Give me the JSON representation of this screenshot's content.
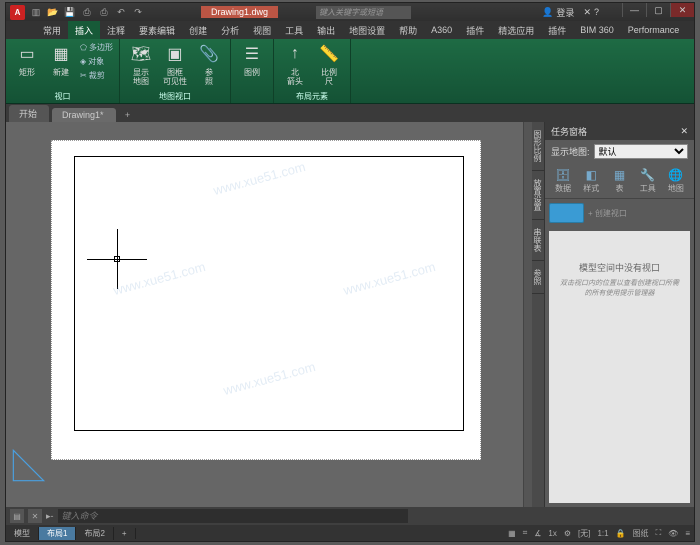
{
  "title_filename": "Drawing1.dwg",
  "search_placeholder": "键入关键字或短语",
  "user_label": "登录",
  "ribbon_tabs": [
    "常用",
    "插入",
    "注释",
    "要素编辑",
    "创建",
    "分析",
    "视图",
    "工具",
    "输出",
    "地图设置",
    "帮助",
    "A360",
    "插件",
    "精选应用",
    "插件",
    "BIM 360",
    "Performance"
  ],
  "ribbon_active_tab": "插入",
  "panels": {
    "viewport": {
      "label": "视口",
      "btn_rect": "矩形",
      "btn_new": "新建",
      "small1": "多边形",
      "small2": "对象",
      "small3": "裁剪"
    },
    "mapview": {
      "label": "地图视口",
      "btn_show": "显示\n地图",
      "btn_imgframe": "图框\n可见性",
      "btn_ref": "参\n照"
    },
    "legend": {
      "label": " ",
      "btn_legend": "图例"
    },
    "layout": {
      "label": "布局元素",
      "btn_north": "北\n箭头",
      "btn_scale": "比例\n尺"
    }
  },
  "doc_tabs": [
    "开始",
    "Drawing1*"
  ],
  "side_tabs": [
    "图形比例",
    "放置设置",
    "串联表",
    "参照"
  ],
  "taskpane": {
    "title": "任务窗格",
    "showmap": "显示地图:",
    "default_option": "默认",
    "tools": [
      "数据",
      "样式",
      "表",
      "工具",
      "地图"
    ],
    "viewport_hint": "+ 创建视口",
    "empty_msg": "模型空间中没有视口",
    "empty_hint": "双击视口内的位置以查看创建视口所需的所有使用提示管理器"
  },
  "cmd_prefix": "▸-",
  "cmd_placeholder": "键入命令",
  "layout_tabs": [
    "模型",
    "布局1",
    "布局2"
  ],
  "status": {
    "scale": "1x",
    "angle": "[无]",
    "ratio": "1:1",
    "mode": "图纸"
  }
}
